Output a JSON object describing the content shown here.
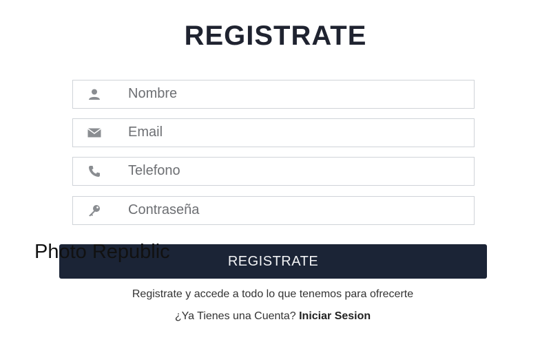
{
  "form": {
    "title": "REGISTRATE",
    "fields": {
      "nombre": {
        "placeholder": "Nombre",
        "value": "",
        "icon": "user-icon"
      },
      "email": {
        "placeholder": "Email",
        "value": "",
        "icon": "envelope-icon"
      },
      "telefono": {
        "placeholder": "Telefono",
        "value": "",
        "icon": "phone-icon"
      },
      "password": {
        "placeholder": "Contraseña",
        "value": "",
        "icon": "key-icon"
      }
    },
    "submit_label": "REGISTRATE",
    "tagline": "Registrate y accede a todo lo que tenemos para ofrecerte",
    "login_prompt": "¿Ya Tienes una Cuenta?",
    "login_link": "Iniciar Sesion"
  },
  "watermark": "Photo Republic",
  "colors": {
    "title": "#1f2330",
    "button_bg": "#1b2436",
    "button_text": "#f2f3f5",
    "border": "#cfd3d8",
    "icon": "#8a8d91"
  }
}
